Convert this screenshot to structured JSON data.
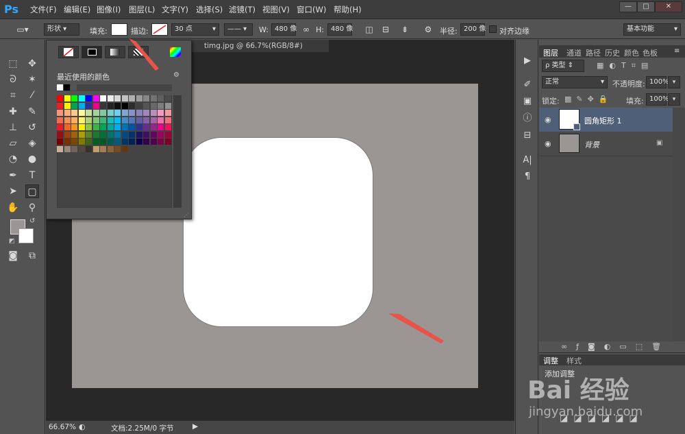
{
  "app": {
    "logo": "Ps"
  },
  "menu": [
    "文件(F)",
    "编辑(E)",
    "图像(I)",
    "图层(L)",
    "文字(Y)",
    "选择(S)",
    "滤镜(T)",
    "视图(V)",
    "窗口(W)",
    "帮助(H)"
  ],
  "options": {
    "shape_mode": "形状",
    "fill_label": "填充:",
    "stroke_label": "描边:",
    "stroke_width": "30 点",
    "w_label": "W:",
    "w_value": "480 像",
    "h_label": "H:",
    "h_value": "480 像",
    "radius_label": "半径:",
    "radius_value": "200 像",
    "align_edges": "对齐边缘",
    "workspace": "基本功能"
  },
  "document": {
    "tab_title": "timg.jpg @ 66.7%(RGB/8#)",
    "zoom": "66.67%",
    "doc_info": "文档:2.25M/0 字节"
  },
  "swatch_popup": {
    "recent_label": "最近使用的颜色",
    "recent_colors": [
      "#ffffff",
      "#000000",
      "#555555"
    ],
    "colors": [
      [
        "#ff0000",
        "#ffff00",
        "#00ff00",
        "#00ffff",
        "#0000ff",
        "#ff00ff",
        "#ffffff",
        "#ebebeb",
        "#d7d7d7",
        "#c3c3c3",
        "#afafaf",
        "#9b9b9b",
        "#878787",
        "#737373",
        "#5f5f5f",
        "#4b4b4b"
      ],
      [
        "#ee1c24",
        "#fff200",
        "#00a651",
        "#00aeef",
        "#2e3192",
        "#ec008c",
        "#373737",
        "#232323",
        "#0f0f0f",
        "#000000",
        "#2d2d2d",
        "#414141",
        "#555555",
        "#696969",
        "#7d7d7d",
        "#919191"
      ],
      [
        "#f7977a",
        "#f9ad81",
        "#fdc68a",
        "#fff79a",
        "#c4df9b",
        "#a3d39c",
        "#82ca9d",
        "#7bcdc8",
        "#6ecff6",
        "#7ea7d8",
        "#8493ca",
        "#8882be",
        "#a187be",
        "#bc8dbf",
        "#f49ac2",
        "#f6989d"
      ],
      [
        "#f26c4f",
        "#f68e55",
        "#fbaf5c",
        "#fff467",
        "#acd372",
        "#7cc576",
        "#3bb878",
        "#1abbb4",
        "#00bff3",
        "#438ccb",
        "#5574b9",
        "#605ca8",
        "#855fa8",
        "#a763a8",
        "#f06eaa",
        "#f26d7d"
      ],
      [
        "#ed1c24",
        "#f26522",
        "#f7941d",
        "#fff200",
        "#8dc63f",
        "#39b54a",
        "#00a651",
        "#00a99d",
        "#00aeef",
        "#0072bc",
        "#0054a6",
        "#2e3192",
        "#662d91",
        "#92278f",
        "#ec008c",
        "#ed145b"
      ],
      [
        "#9e0b0f",
        "#a0410d",
        "#a36209",
        "#aba000",
        "#598527",
        "#1a7b30",
        "#007236",
        "#00746b",
        "#0076a3",
        "#004b80",
        "#003471",
        "#1b1464",
        "#440e62",
        "#630460",
        "#9e005d",
        "#9e0039"
      ],
      [
        "#790000",
        "#7b2e00",
        "#7d4900",
        "#827b00",
        "#406618",
        "#005e20",
        "#005826",
        "#005952",
        "#005b7f",
        "#003663",
        "#002157",
        "#0d004c",
        "#32004b",
        "#4b0049",
        "#7b0046",
        "#7a0026"
      ],
      [
        "#c7b299",
        "#998675",
        "#736357",
        "#534741",
        "#37302d",
        "#c69c6d",
        "#a67c52",
        "#8c6239",
        "#754c24",
        "#603913"
      ]
    ]
  },
  "right_panel": {
    "tabs": [
      "图层",
      "通道",
      "路径",
      "历史",
      "颜色",
      "色板"
    ],
    "filter_kind": "ρ 类型",
    "blend_mode": "正常",
    "opacity_label": "不透明度:",
    "opacity_value": "100%",
    "lock_label": "锁定:",
    "fill_label": "填充:",
    "fill_value": "100%",
    "layers": [
      {
        "name": "圆角矩形 1",
        "selected": true
      },
      {
        "name": "背景",
        "selected": false
      }
    ],
    "adjust_tabs": [
      "调整",
      "样式"
    ],
    "adjust_label": "添加调整"
  },
  "watermark": {
    "brand": "Bai 经验",
    "url": "jingyan.baidu.com"
  },
  "colors": {
    "canvas": "#9b9594",
    "shape": "#ffffff",
    "arrow": "#e8534a",
    "selected_layer": "#4f5f77"
  }
}
